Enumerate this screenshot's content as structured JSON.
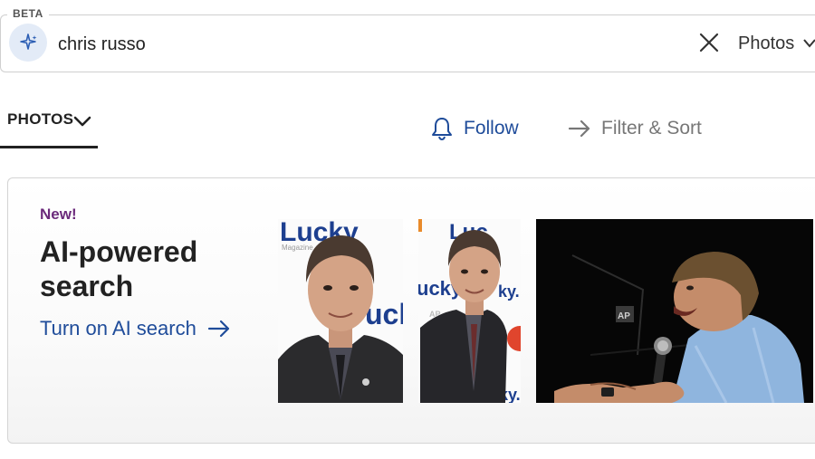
{
  "search": {
    "beta_label": "BETA",
    "query": "chris russo",
    "scope": "Photos"
  },
  "tabs": {
    "photos_label": "PHOTOS",
    "follow_label": "Follow",
    "filter_label": "Filter & Sort"
  },
  "ai_card": {
    "new_label": "New!",
    "title": "AI-powered search",
    "cta": "Turn on AI search"
  },
  "thumbnails": [
    {
      "name": "portrait-lucky-backdrop-1",
      "backdrop_text": "Lucky",
      "backdrop_text_2": "ucl",
      "backdrop_text_3": "Magazine"
    },
    {
      "name": "portrait-lucky-backdrop-2",
      "backdrop_text": "Luc",
      "backdrop_text_2": "ucky",
      "backdrop_text_3": "ky.",
      "watermark": "AP"
    },
    {
      "name": "man-speaking-microphone",
      "watermark": "AP"
    }
  ],
  "colors": {
    "link_blue": "#1f4c9a",
    "new_purple": "#6b2a7b",
    "muted_gray": "#777777"
  }
}
